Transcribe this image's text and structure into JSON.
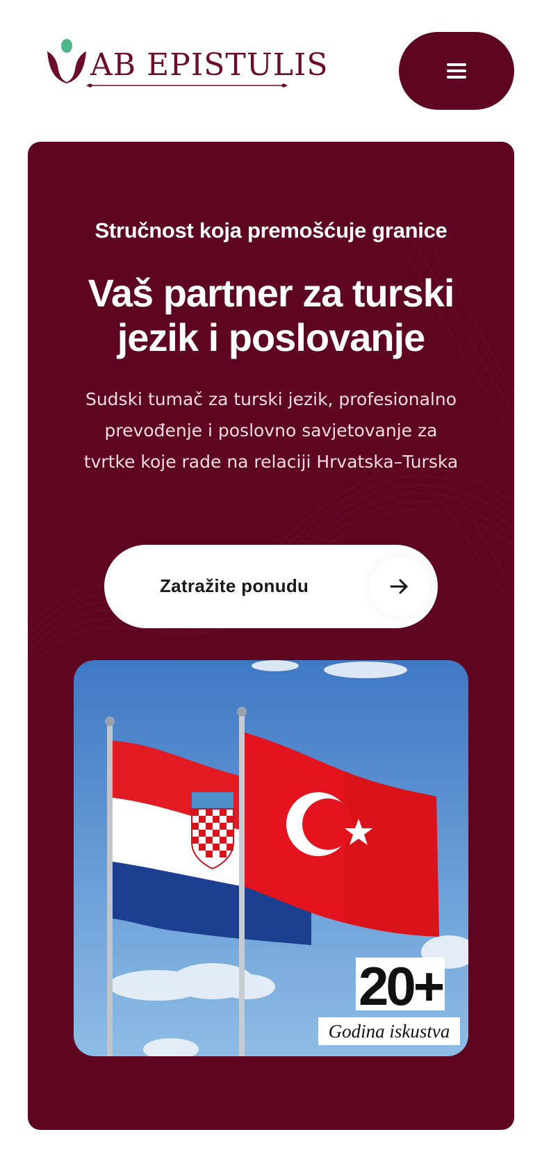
{
  "header": {
    "brand_name": "AB EPISTULIS",
    "menu_icon": "hamburger-menu-icon"
  },
  "hero": {
    "eyebrow": "Stručnost koja premošćuje granice",
    "headline": "Vaš partner za turski jezik i poslovanje",
    "subtitle": "Sudski tumač za turski jezik, profesionalno prevođenje i poslovno savjetovanje za tvrtke koje rade na relaciji Hrvatska–Turska",
    "cta_label": "Zatražite ponudu",
    "cta_icon": "arrow-right-icon"
  },
  "photo": {
    "subject": "Croatian and Turkish flags",
    "stat_number": "20+",
    "stat_caption": "Godina iskustva"
  },
  "colors": {
    "brand": "#5e0520",
    "logo_accent": "#4fb58a",
    "text_light": "#ffffff"
  }
}
